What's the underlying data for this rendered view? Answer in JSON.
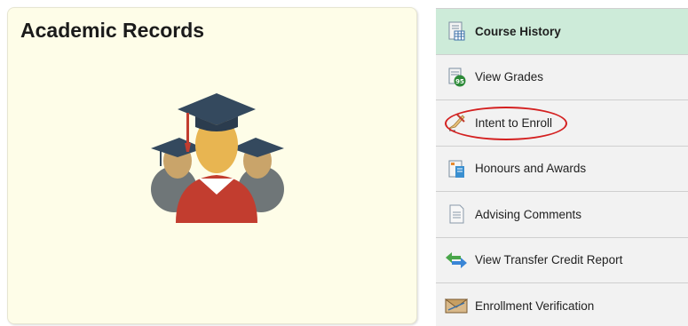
{
  "tile": {
    "title": "Academic Records",
    "icon": "graduates-icon"
  },
  "nav": {
    "items": [
      {
        "label": "Course History",
        "icon": "course-history-icon",
        "active": true
      },
      {
        "label": "View Grades",
        "icon": "grades-icon",
        "badge": "95"
      },
      {
        "label": "Intent to Enroll",
        "icon": "quill-pen-icon",
        "annotated": true
      },
      {
        "label": "Honours and Awards",
        "icon": "awards-doc-icon"
      },
      {
        "label": "Advising Comments",
        "icon": "comments-doc-icon"
      },
      {
        "label": "View Transfer Credit Report",
        "icon": "transfer-arrows-icon"
      },
      {
        "label": "Enrollment Verification",
        "icon": "envelope-icon"
      }
    ]
  },
  "colors": {
    "tile_bg": "#fefde8",
    "active_bg": "#cdebd9",
    "item_bg": "#f2f2f2",
    "annotation": "#d42020"
  }
}
